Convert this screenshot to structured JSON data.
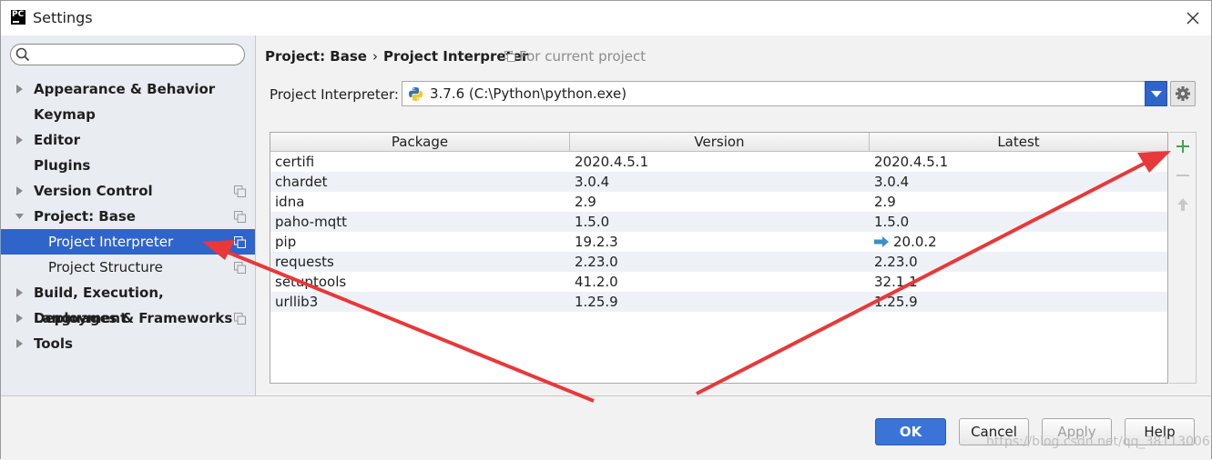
{
  "window": {
    "title": "Settings",
    "app_icon_text": "PC"
  },
  "sidebar": {
    "search_placeholder": "",
    "items": [
      {
        "label": "Appearance & Behavior",
        "expandable": true,
        "level": 0
      },
      {
        "label": "Keymap",
        "expandable": false,
        "level": 0
      },
      {
        "label": "Editor",
        "expandable": true,
        "level": 0
      },
      {
        "label": "Plugins",
        "expandable": false,
        "level": 0
      },
      {
        "label": "Version Control",
        "expandable": true,
        "level": 0,
        "project_scoped": true
      },
      {
        "label": "Project: Base",
        "expandable": true,
        "expanded": true,
        "level": 0,
        "project_scoped": true
      },
      {
        "label": "Project Interpreter",
        "level": 1,
        "selected": true,
        "project_scoped": true
      },
      {
        "label": "Project Structure",
        "level": 1,
        "project_scoped": true
      },
      {
        "label": "Build, Execution, Deployment",
        "expandable": true,
        "level": 0
      },
      {
        "label": "Languages & Frameworks",
        "expandable": true,
        "level": 0,
        "project_scoped": true
      },
      {
        "label": "Tools",
        "expandable": true,
        "level": 0
      }
    ]
  },
  "content": {
    "breadcrumb": {
      "parent": "Project: Base",
      "separator": "›",
      "current": "Project Interpreter"
    },
    "scope_note": "For current project",
    "interpreter": {
      "label": "Project Interpreter:",
      "value": "3.7.6 (C:\\Python\\python.exe)"
    },
    "table": {
      "headers": [
        "Package",
        "Version",
        "Latest"
      ],
      "rows": [
        {
          "package": "certifi",
          "version": "2020.4.5.1",
          "latest": "2020.4.5.1",
          "upgrade": false
        },
        {
          "package": "chardet",
          "version": "3.0.4",
          "latest": "3.0.4",
          "upgrade": false
        },
        {
          "package": "idna",
          "version": "2.9",
          "latest": "2.9",
          "upgrade": false
        },
        {
          "package": "paho-mqtt",
          "version": "1.5.0",
          "latest": "1.5.0",
          "upgrade": false
        },
        {
          "package": "pip",
          "version": "19.2.3",
          "latest": "20.0.2",
          "upgrade": true
        },
        {
          "package": "requests",
          "version": "2.23.0",
          "latest": "2.23.0",
          "upgrade": false
        },
        {
          "package": "setuptools",
          "version": "41.2.0",
          "latest": "32.1.1",
          "upgrade": false
        },
        {
          "package": "urllib3",
          "version": "1.25.9",
          "latest": "1.25.9",
          "upgrade": false
        }
      ]
    }
  },
  "footer": {
    "ok_label": "OK",
    "cancel_label": "Cancel",
    "apply_label": "Apply",
    "help_label": "Help",
    "watermark": "https://blog.csdn.net/qq_38113006"
  },
  "colors": {
    "accent": "#2f65ca",
    "annotation_arrow": "#e8383a",
    "add_icon": "#3aa64a"
  }
}
